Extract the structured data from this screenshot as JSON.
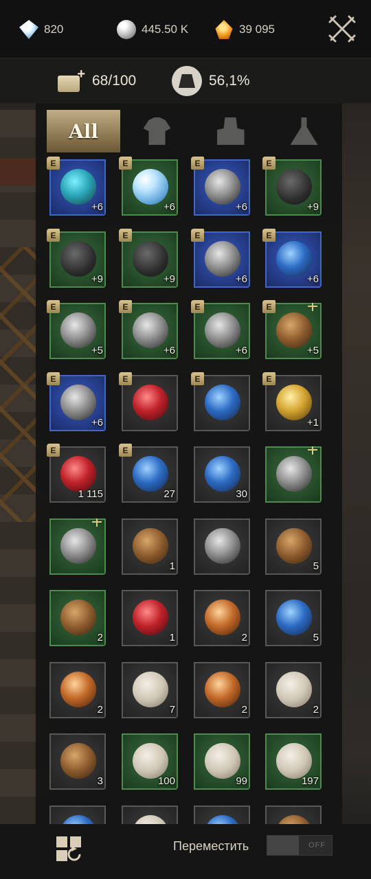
{
  "currencies": [
    {
      "icon": "diamond-icon",
      "value": "820"
    },
    {
      "icon": "silver-coin-icon",
      "value": "445.50 K"
    },
    {
      "icon": "amber-gem-icon",
      "value": "39 095"
    }
  ],
  "stats": {
    "inventory_slots": "68/100",
    "weight": "56,1%"
  },
  "tabs": [
    {
      "label": "All",
      "icon": "",
      "active": true
    },
    {
      "label": "",
      "icon": "armor-icon",
      "active": false
    },
    {
      "label": "",
      "icon": "material-bars-icon",
      "active": false
    },
    {
      "label": "",
      "icon": "potion-flask-icon",
      "active": false
    }
  ],
  "items": [
    {
      "name": "staff-item",
      "rarity": "blue",
      "badge": "E",
      "qty": "+6",
      "glyph": "g-teal",
      "scale": false
    },
    {
      "name": "orb-item",
      "rarity": "green",
      "badge": "E",
      "qty": "+6",
      "glyph": "g-orb",
      "scale": false
    },
    {
      "name": "chest-armor-item",
      "rarity": "blue",
      "badge": "E",
      "qty": "+6",
      "glyph": "g-metal",
      "scale": false
    },
    {
      "name": "leg-armor-item",
      "rarity": "green",
      "badge": "E",
      "qty": "+9",
      "glyph": "g-dark",
      "scale": false
    },
    {
      "name": "gloves-item",
      "rarity": "green",
      "badge": "E",
      "qty": "+9",
      "glyph": "g-dark",
      "scale": false
    },
    {
      "name": "boots-item",
      "rarity": "green",
      "badge": "E",
      "qty": "+9",
      "glyph": "g-dark",
      "scale": false
    },
    {
      "name": "helmet-item",
      "rarity": "blue",
      "badge": "E",
      "qty": "+6",
      "glyph": "g-metal",
      "scale": false
    },
    {
      "name": "necklace-item",
      "rarity": "blue",
      "badge": "E",
      "qty": "+6",
      "glyph": "g-blue",
      "scale": false
    },
    {
      "name": "bracelet-item",
      "rarity": "green",
      "badge": "E",
      "qty": "+5",
      "glyph": "g-metal",
      "scale": false
    },
    {
      "name": "ring-item",
      "rarity": "green",
      "badge": "E",
      "qty": "+6",
      "glyph": "g-metal",
      "scale": false
    },
    {
      "name": "knife-item",
      "rarity": "green",
      "badge": "E",
      "qty": "+6",
      "glyph": "g-metal",
      "scale": false
    },
    {
      "name": "pickaxe-item",
      "rarity": "green",
      "badge": "E",
      "qty": "+5",
      "glyph": "g-wood",
      "scale": true
    },
    {
      "name": "hammer-item",
      "rarity": "blue",
      "badge": "E",
      "qty": "+6",
      "glyph": "g-metal",
      "scale": false
    },
    {
      "name": "red-banner-item",
      "rarity": "gray",
      "badge": "E",
      "qty": "",
      "glyph": "g-red",
      "scale": false
    },
    {
      "name": "blue-banner-item",
      "rarity": "gray",
      "badge": "E",
      "qty": "",
      "glyph": "g-blue",
      "scale": false
    },
    {
      "name": "ship-item",
      "rarity": "gray",
      "badge": "E",
      "qty": "+1",
      "glyph": "g-gold",
      "scale": false
    },
    {
      "name": "red-potion-item",
      "rarity": "gray",
      "badge": "E",
      "qty": "1 115",
      "glyph": "g-red",
      "scale": false
    },
    {
      "name": "blue-vial-item",
      "rarity": "gray",
      "badge": "E",
      "qty": "27",
      "glyph": "g-blue",
      "scale": false
    },
    {
      "name": "blueprint-scroll-item",
      "rarity": "gray",
      "badge": "",
      "qty": "30",
      "glyph": "g-blue",
      "scale": false
    },
    {
      "name": "chain-item",
      "rarity": "green",
      "badge": "",
      "qty": "",
      "glyph": "g-metal",
      "scale": true
    },
    {
      "name": "dagger-item",
      "rarity": "green",
      "badge": "",
      "qty": "",
      "glyph": "g-metal",
      "scale": true
    },
    {
      "name": "wooden-chest-item",
      "rarity": "gray",
      "badge": "",
      "qty": "1",
      "glyph": "g-wood",
      "scale": false
    },
    {
      "name": "silver-chest-item",
      "rarity": "gray",
      "badge": "",
      "qty": "",
      "glyph": "g-metal",
      "scale": false
    },
    {
      "name": "carved-box-item",
      "rarity": "gray",
      "badge": "",
      "qty": "5",
      "glyph": "g-wood",
      "scale": false
    },
    {
      "name": "green-chest-item",
      "rarity": "green",
      "badge": "",
      "qty": "2",
      "glyph": "g-wood",
      "scale": false
    },
    {
      "name": "red-flask-item",
      "rarity": "gray",
      "badge": "",
      "qty": "1",
      "glyph": "g-red",
      "scale": false
    },
    {
      "name": "steak-item",
      "rarity": "gray",
      "badge": "",
      "qty": "2",
      "glyph": "g-food",
      "scale": false
    },
    {
      "name": "blue-flask-item",
      "rarity": "gray",
      "badge": "",
      "qty": "5",
      "glyph": "g-blue",
      "scale": false
    },
    {
      "name": "roast-chicken-item",
      "rarity": "gray",
      "badge": "",
      "qty": "2",
      "glyph": "g-food",
      "scale": false
    },
    {
      "name": "white-vase-item",
      "rarity": "gray",
      "badge": "",
      "qty": "7",
      "glyph": "g-paper",
      "scale": false
    },
    {
      "name": "stew-item",
      "rarity": "gray",
      "badge": "",
      "qty": "2",
      "glyph": "g-food",
      "scale": false
    },
    {
      "name": "soup-item",
      "rarity": "gray",
      "badge": "",
      "qty": "2",
      "glyph": "g-paper",
      "scale": false
    },
    {
      "name": "beer-mug-item",
      "rarity": "gray",
      "badge": "",
      "qty": "3",
      "glyph": "g-wood",
      "scale": false
    },
    {
      "name": "exp-scroll-item",
      "rarity": "green",
      "badge": "",
      "qty": "100",
      "glyph": "g-paper",
      "scale": false
    },
    {
      "name": "scroll-item",
      "rarity": "green",
      "badge": "",
      "qty": "99",
      "glyph": "g-paper",
      "scale": false
    },
    {
      "name": "purple-scroll-item",
      "rarity": "green",
      "badge": "",
      "qty": "197",
      "glyph": "g-paper",
      "scale": false
    },
    {
      "name": "scroll-partial-1",
      "rarity": "gray",
      "badge": "",
      "qty": "",
      "glyph": "g-blue",
      "scale": false
    },
    {
      "name": "scroll-partial-2",
      "rarity": "gray",
      "badge": "",
      "qty": "",
      "glyph": "g-paper",
      "scale": false
    },
    {
      "name": "scroll-partial-3",
      "rarity": "gray",
      "badge": "",
      "qty": "",
      "glyph": "g-blue",
      "scale": false
    },
    {
      "name": "vase-partial-4",
      "rarity": "gray",
      "badge": "",
      "qty": "",
      "glyph": "g-wood",
      "scale": false
    }
  ],
  "bottom": {
    "move_label": "Переместить",
    "toggle_state": "OFF"
  }
}
